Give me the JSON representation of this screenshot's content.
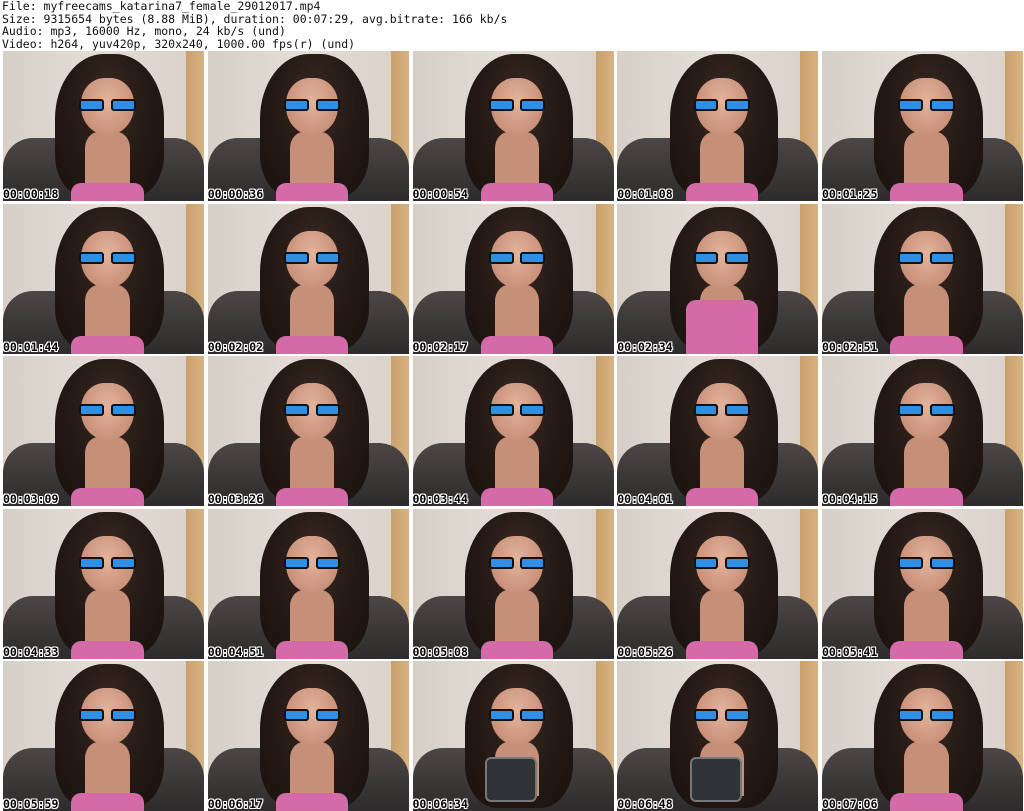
{
  "header": {
    "file_line": "File: myfreecams_katarina7_female_29012017.mp4",
    "size_line": "Size: 9315654 bytes (8.88 MiB), duration: 00:07:29, avg.bitrate: 166 kb/s",
    "audio_line": "Audio: mp3, 16000 Hz, mono, 24 kb/s (und)",
    "video_line": "Video: h264, yuv420p, 320x240, 1000.00 fps(r) (und)"
  },
  "thumbnails": [
    {
      "timestamp": "00:00:18"
    },
    {
      "timestamp": "00:00:36"
    },
    {
      "timestamp": "00:00:54"
    },
    {
      "timestamp": "00:01:08"
    },
    {
      "timestamp": "00:01:25"
    },
    {
      "timestamp": "00:01:44"
    },
    {
      "timestamp": "00:02:02"
    },
    {
      "timestamp": "00:02:17"
    },
    {
      "timestamp": "00:02:34"
    },
    {
      "timestamp": "00:02:51"
    },
    {
      "timestamp": "00:03:09"
    },
    {
      "timestamp": "00:03:26"
    },
    {
      "timestamp": "00:03:44"
    },
    {
      "timestamp": "00:04:01"
    },
    {
      "timestamp": "00:04:15"
    },
    {
      "timestamp": "00:04:33"
    },
    {
      "timestamp": "00:04:51"
    },
    {
      "timestamp": "00:05:08"
    },
    {
      "timestamp": "00:05:26"
    },
    {
      "timestamp": "00:05:41"
    },
    {
      "timestamp": "00:05:59"
    },
    {
      "timestamp": "00:06:17"
    },
    {
      "timestamp": "00:06:34"
    },
    {
      "timestamp": "00:06:48"
    },
    {
      "timestamp": "00:07:06"
    }
  ]
}
